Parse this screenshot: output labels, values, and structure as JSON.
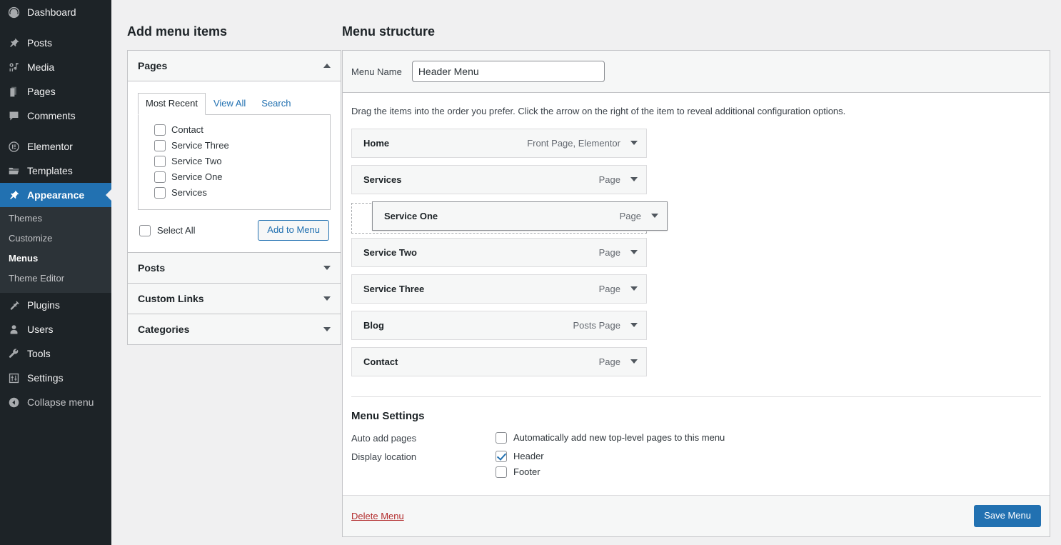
{
  "sidebar": {
    "items": [
      {
        "label": "Dashboard",
        "icon": "dashboard-icon",
        "current": false,
        "gap_after": true
      },
      {
        "label": "Posts",
        "icon": "pin-icon",
        "current": false,
        "gap_after": false
      },
      {
        "label": "Media",
        "icon": "media-icon",
        "current": false,
        "gap_after": false
      },
      {
        "label": "Pages",
        "icon": "pages-icon",
        "current": false,
        "gap_after": false
      },
      {
        "label": "Comments",
        "icon": "comments-icon",
        "current": false,
        "gap_after": true
      },
      {
        "label": "Elementor",
        "icon": "elementor-icon",
        "current": false,
        "gap_after": false
      },
      {
        "label": "Templates",
        "icon": "folder-icon",
        "current": false,
        "gap_after": false
      },
      {
        "label": "Appearance",
        "icon": "appearance-brush-icon",
        "current": true,
        "gap_after": false
      }
    ],
    "submenu": [
      {
        "label": "Themes",
        "current": false
      },
      {
        "label": "Customize",
        "current": false
      },
      {
        "label": "Menus",
        "current": true
      },
      {
        "label": "Theme Editor",
        "current": false
      }
    ],
    "items_after": [
      {
        "label": "Plugins",
        "icon": "plug-icon",
        "current": false
      },
      {
        "label": "Users",
        "icon": "user-icon",
        "current": false
      },
      {
        "label": "Tools",
        "icon": "wrench-icon",
        "current": false
      },
      {
        "label": "Settings",
        "icon": "settings-sliders-icon",
        "current": false
      },
      {
        "label": "Collapse menu",
        "icon": "collapse-arrow-icon",
        "current": false
      }
    ],
    "accent_color": "#2271b1",
    "bg_color": "#1d2327",
    "submenu_bg_color": "#2c3338"
  },
  "add_menu_items": {
    "title": "Add menu items",
    "pages": {
      "title": "Pages",
      "expanded": true,
      "tabs": [
        {
          "label": "Most Recent",
          "active": true
        },
        {
          "label": "View All",
          "active": false
        },
        {
          "label": "Search",
          "active": false
        }
      ],
      "checkbox_items": [
        {
          "label": "Contact",
          "checked": false
        },
        {
          "label": "Service Three",
          "checked": false
        },
        {
          "label": "Service Two",
          "checked": false
        },
        {
          "label": "Service One",
          "checked": false
        },
        {
          "label": "Services",
          "checked": false
        }
      ],
      "select_all_label": "Select All",
      "select_all_checked": false,
      "add_to_menu_label": "Add to Menu"
    },
    "collapsed_sections": [
      {
        "title": "Posts"
      },
      {
        "title": "Custom Links"
      },
      {
        "title": "Categories"
      }
    ]
  },
  "menu_structure": {
    "title": "Menu structure",
    "menu_name_label": "Menu Name",
    "menu_name_value": "Header Menu",
    "menu_name_placeholder": "Menu Name",
    "hint": "Drag the items into the order you prefer. Click the arrow on the right of the item to reveal additional configuration options.",
    "items": [
      {
        "name": "Home",
        "meta": "Front Page, Elementor",
        "state": "normal"
      },
      {
        "name": "Services",
        "meta": "Page",
        "state": "normal"
      },
      {
        "name": "Service One",
        "meta": "Page",
        "state": "dragging"
      },
      {
        "name": "Service Two",
        "meta": "Page",
        "state": "normal"
      },
      {
        "name": "Service Three",
        "meta": "Page",
        "state": "normal"
      },
      {
        "name": "Blog",
        "meta": "Posts Page",
        "state": "normal"
      },
      {
        "name": "Contact",
        "meta": "Page",
        "state": "normal"
      }
    ]
  },
  "menu_settings": {
    "title": "Menu Settings",
    "auto_add_label": "Auto add pages",
    "auto_add_option_label": "Automatically add new top-level pages to this menu",
    "auto_add_checked": false,
    "display_location_label": "Display location",
    "locations": [
      {
        "label": "Header",
        "checked": true
      },
      {
        "label": "Footer",
        "checked": false
      }
    ]
  },
  "footer": {
    "delete_label": "Delete Menu",
    "save_label": "Save Menu",
    "save_color": "#2271b1",
    "delete_color": "#b32d2e"
  }
}
